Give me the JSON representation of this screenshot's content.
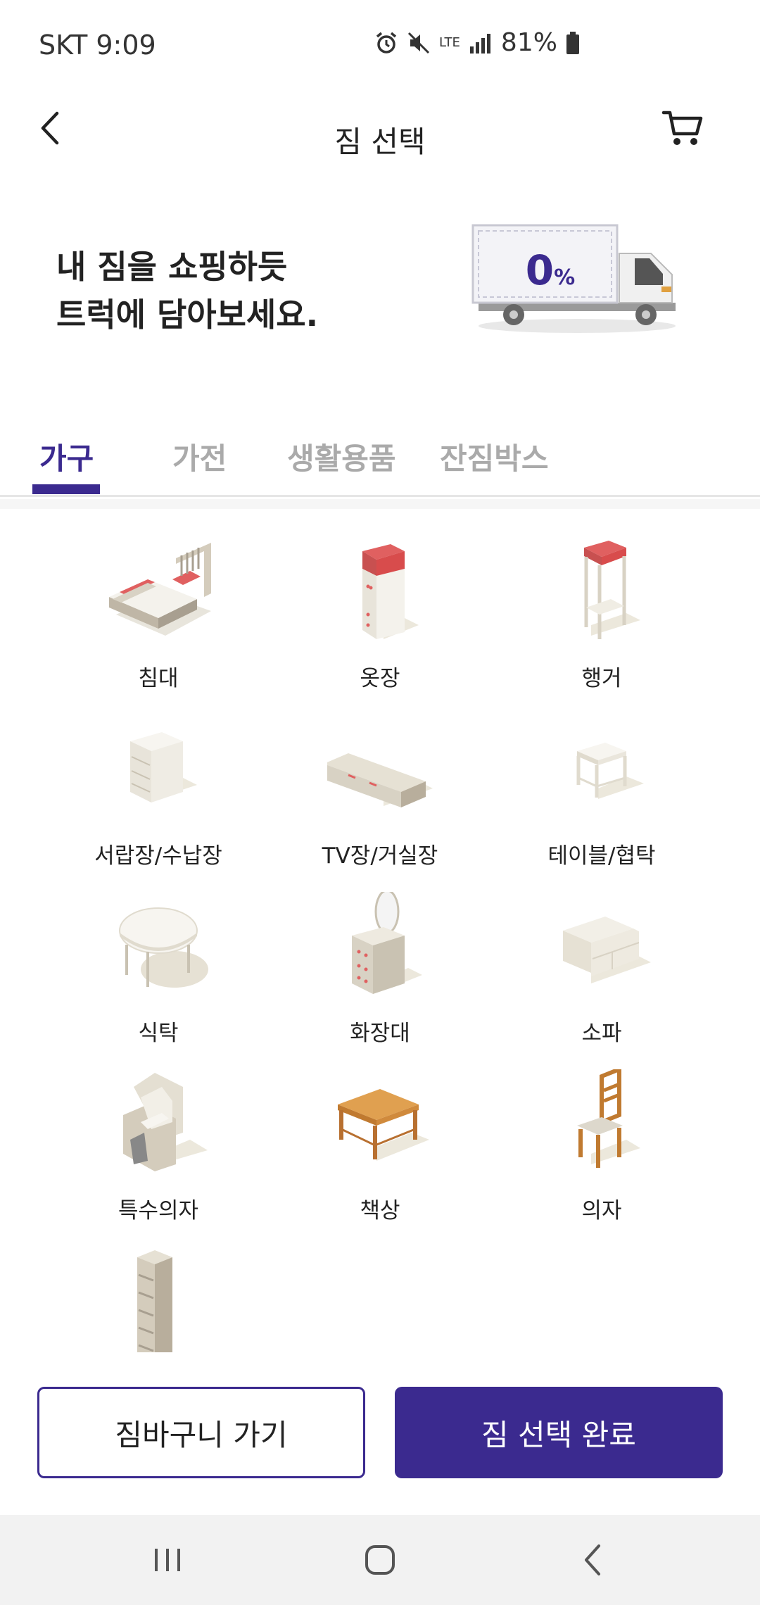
{
  "status_bar": {
    "carrier_time": "SKT 9:09",
    "network": "LTE",
    "battery": "81%"
  },
  "header": {
    "title": "짐 선택"
  },
  "banner": {
    "line1": "내 짐을 쇼핑하듯",
    "line2": "트럭에 담아보세요.",
    "truck_percent_value": "0",
    "truck_percent_unit": "%"
  },
  "tabs": [
    {
      "label": "가구",
      "active": true
    },
    {
      "label": "가전",
      "active": false
    },
    {
      "label": "생활용품",
      "active": false
    },
    {
      "label": "잔짐박스",
      "active": false
    }
  ],
  "items": [
    {
      "label": "침대",
      "icon": "bed-icon"
    },
    {
      "label": "옷장",
      "icon": "wardrobe-icon"
    },
    {
      "label": "행거",
      "icon": "hanger-rack-icon"
    },
    {
      "label": "서랍장/수납장",
      "icon": "drawer-chest-icon"
    },
    {
      "label": "TV장/거실장",
      "icon": "tv-stand-icon"
    },
    {
      "label": "테이블/협탁",
      "icon": "side-table-icon"
    },
    {
      "label": "식탁",
      "icon": "dining-table-icon"
    },
    {
      "label": "화장대",
      "icon": "vanity-icon"
    },
    {
      "label": "소파",
      "icon": "sofa-icon"
    },
    {
      "label": "특수의자",
      "icon": "massage-chair-icon"
    },
    {
      "label": "책상",
      "icon": "desk-icon"
    },
    {
      "label": "의자",
      "icon": "chair-icon"
    },
    {
      "label": "",
      "icon": "bookshelf-icon"
    }
  ],
  "buttons": {
    "cart": "짐바구니 가기",
    "complete": "짐 선택 완료"
  },
  "colors": {
    "accent": "#3b2a8f",
    "tab_inactive": "#aaaaaa",
    "furniture_red": "#e06060",
    "furniture_cream": "#ece8dc",
    "wood": "#d08a3c"
  }
}
